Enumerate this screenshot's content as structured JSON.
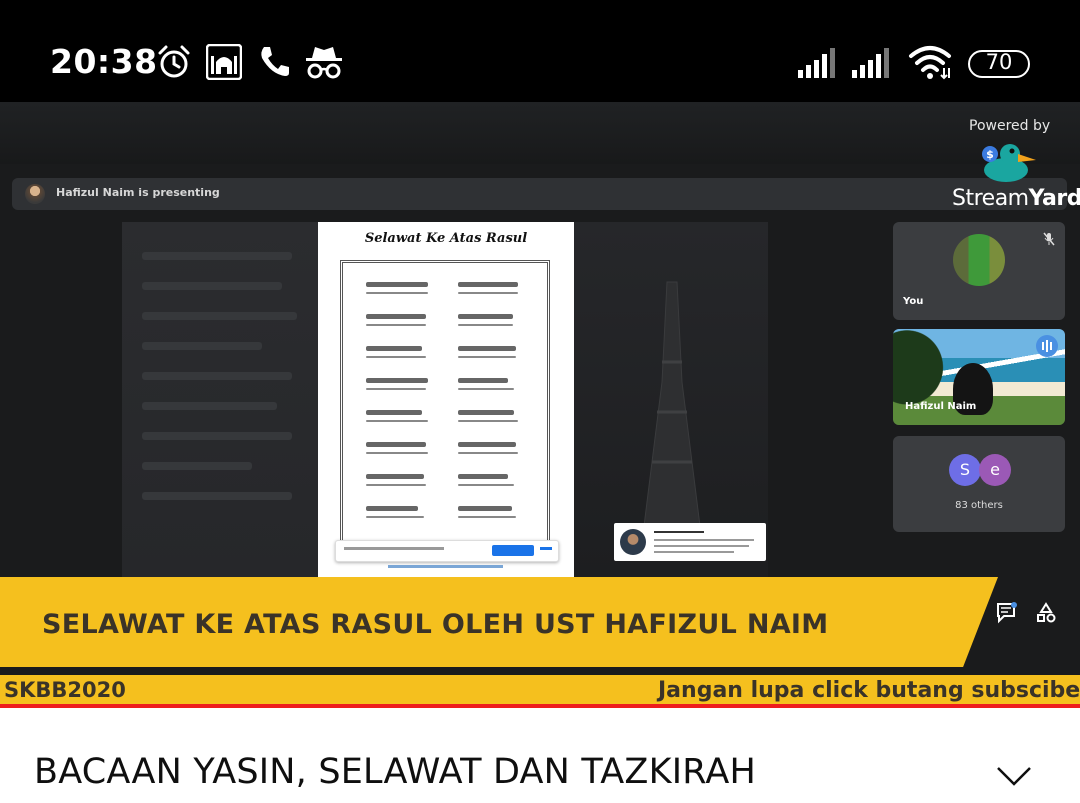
{
  "status_bar": {
    "time": "20:38",
    "battery": "70",
    "icons": [
      "alarm-icon",
      "mosque-app-icon",
      "phone-call-icon",
      "incognito-icon",
      "signal-icon",
      "signal-icon-2",
      "wifi-icon",
      "battery-icon"
    ]
  },
  "video": {
    "presenting_text": "Hafizul Naim is presenting",
    "powered_by": "Powered by",
    "brand_left": "Stream",
    "brand_right": "Yard",
    "document_title": "Selawat Ke Atas Rasul",
    "participants": {
      "you_label": "You",
      "speaker_label": "Hafizul Naim",
      "others_label": "83 others",
      "avatar_initials": [
        "S",
        "e"
      ],
      "avatar_colors": [
        "#6e6ee6",
        "#9b59b6"
      ]
    },
    "banner_text": "SELAWAT KE ATAS RASUL OLEH UST HAFIZUL NAIM",
    "ticker_left": "SKBB2020",
    "ticker_right": "Jangan lupa click butang subscibe da",
    "progress_fraction": 1.0
  },
  "video_title": "BACAAN YASIN, SELAWAT DAN TAZKIRAH",
  "colors": {
    "banner": "#f5c01e",
    "progress": "#ee1d1d",
    "status_bg": "#000000"
  }
}
